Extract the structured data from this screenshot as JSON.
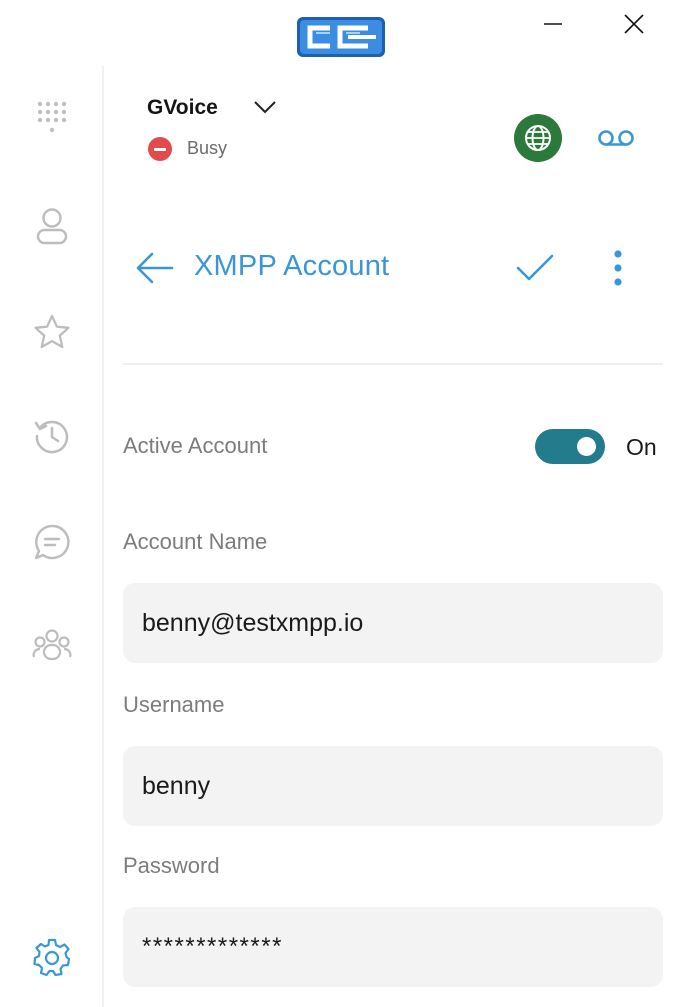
{
  "window": {
    "logo_icon": "cc-logo-icon"
  },
  "sidebar": {
    "items": [
      {
        "icon": "dialpad-icon"
      },
      {
        "icon": "contact-icon"
      },
      {
        "icon": "star-icon"
      },
      {
        "icon": "history-icon"
      },
      {
        "icon": "chat-icon"
      },
      {
        "icon": "group-icon"
      },
      {
        "icon": "settings-icon"
      }
    ]
  },
  "header": {
    "account_name": "GVoice",
    "status": "Busy",
    "status_color": "#e24b4b",
    "globe_color": "#2b7a3b"
  },
  "page": {
    "title": "XMPP Account",
    "accent_color": "#3a97d6"
  },
  "form": {
    "active_label": "Active Account",
    "active_value": "On",
    "toggle_on": true,
    "toggle_color": "#227c8c",
    "account_name_label": "Account Name",
    "account_name_value": "benny@testxmpp.io",
    "username_label": "Username",
    "username_value": "benny",
    "password_label": "Password",
    "password_value": "*************"
  }
}
